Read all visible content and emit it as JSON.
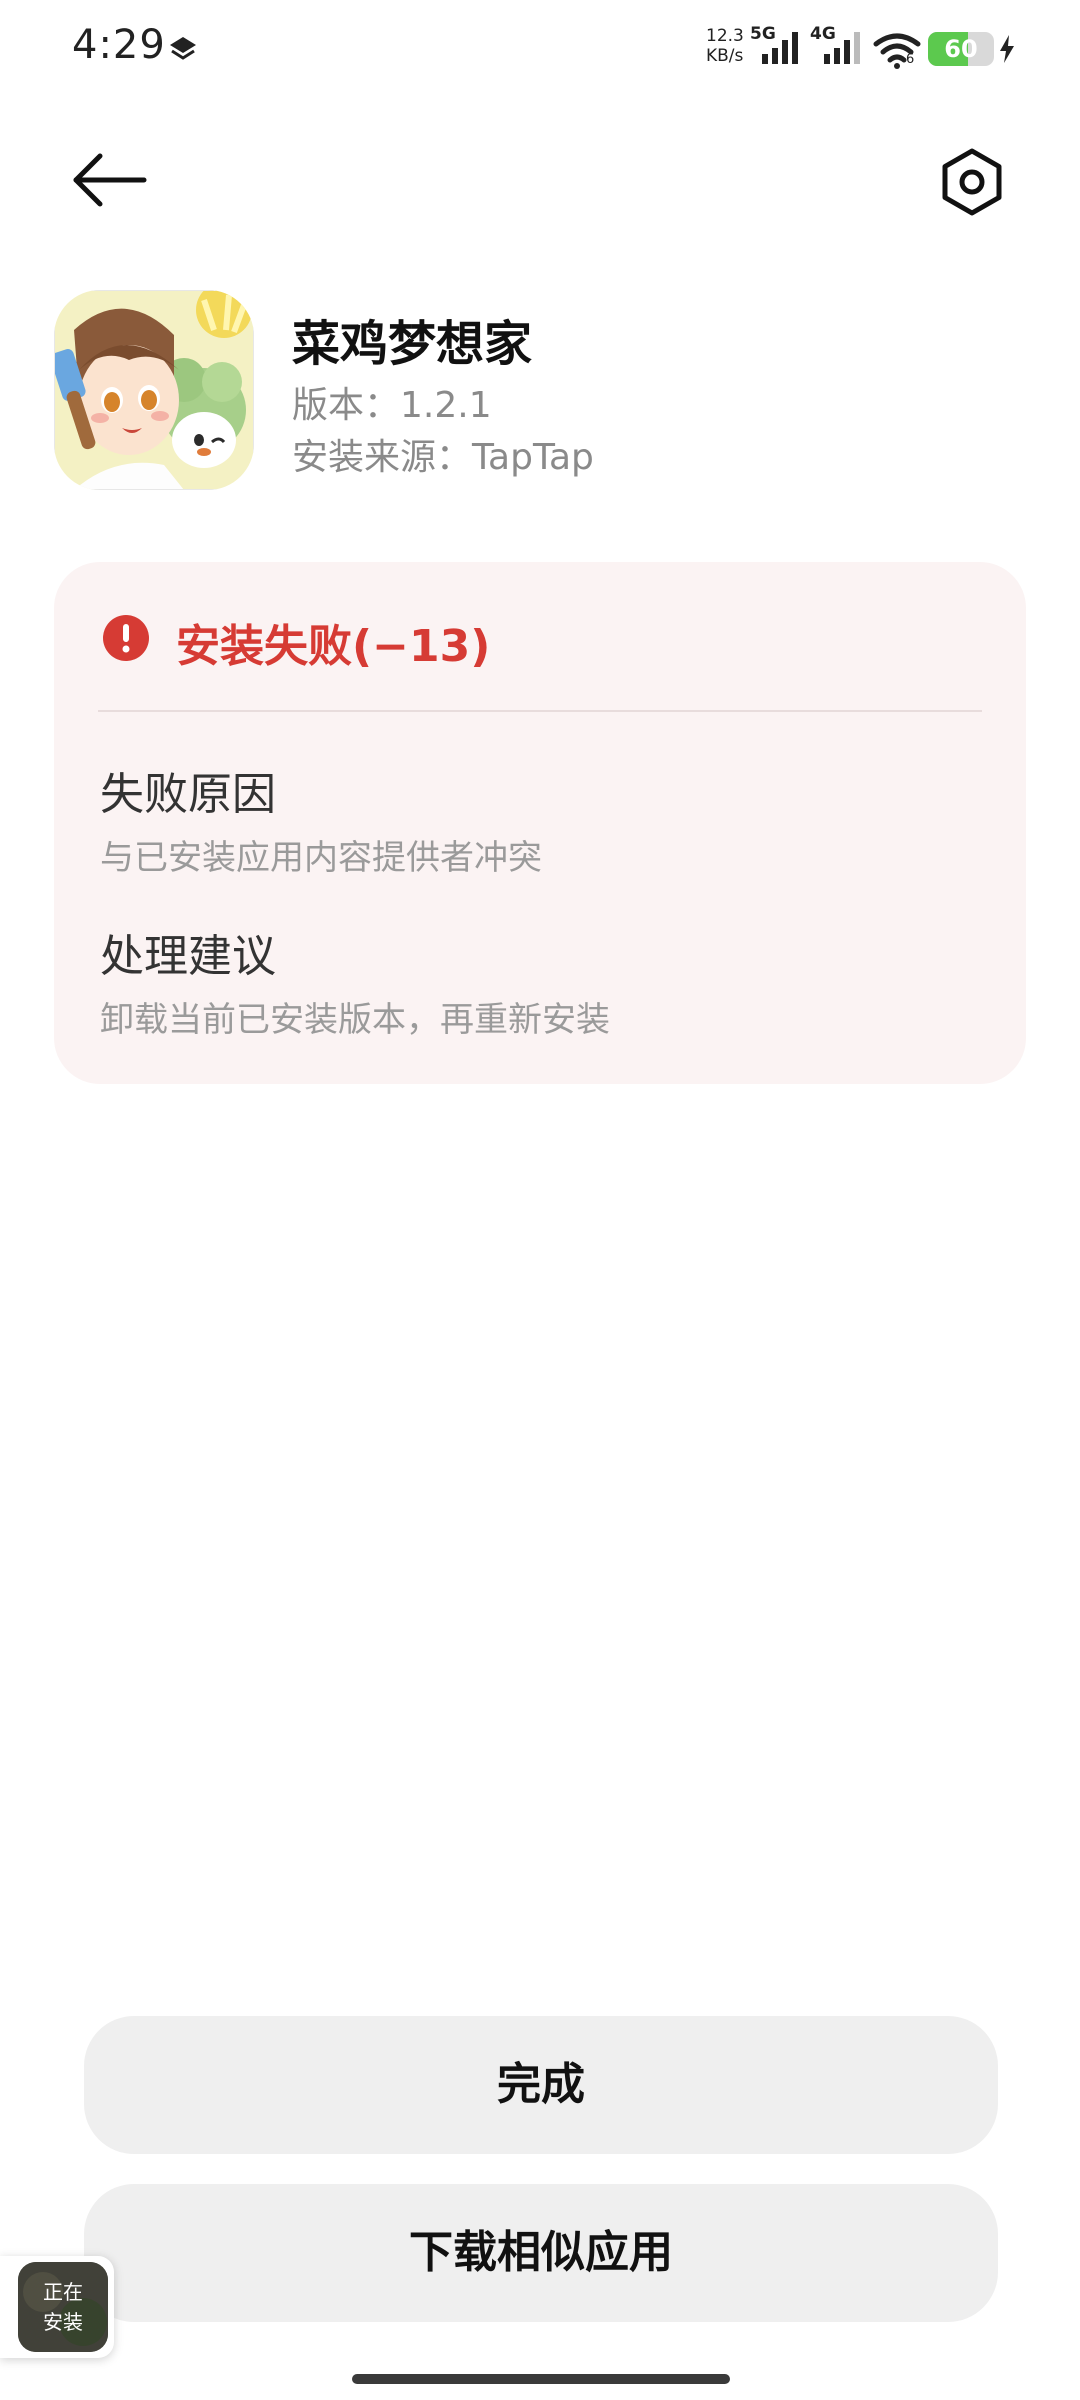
{
  "status_bar": {
    "time": "4:29",
    "net_speed_value": "12.3",
    "net_speed_unit": "KB/s",
    "signal_1_label": "5G",
    "signal_2_label": "4G",
    "wifi_sub": "6",
    "battery_level": 60,
    "battery_text": "60"
  },
  "header": {
    "back_icon": "arrow-left-icon",
    "settings_icon": "settings-hex-icon"
  },
  "app": {
    "name": "菜鸡梦想家",
    "version": "版本：1.2.1",
    "source": "安装来源：TapTap"
  },
  "error": {
    "title": "安装失败(−13)",
    "reason_heading": "失败原因",
    "reason_body": "与已安装应用内容提供者冲突",
    "advice_heading": "处理建议",
    "advice_body": "卸载当前已安装版本，再重新安装"
  },
  "buttons": {
    "done": "完成",
    "download_similar": "下载相似应用"
  },
  "install_bubble": {
    "line1": "正在",
    "line2": "安装"
  },
  "colors": {
    "error_red": "#d63b34",
    "card_bg": "#fbf3f3",
    "button_bg": "#efefef",
    "battery_green": "#5cc94e"
  }
}
